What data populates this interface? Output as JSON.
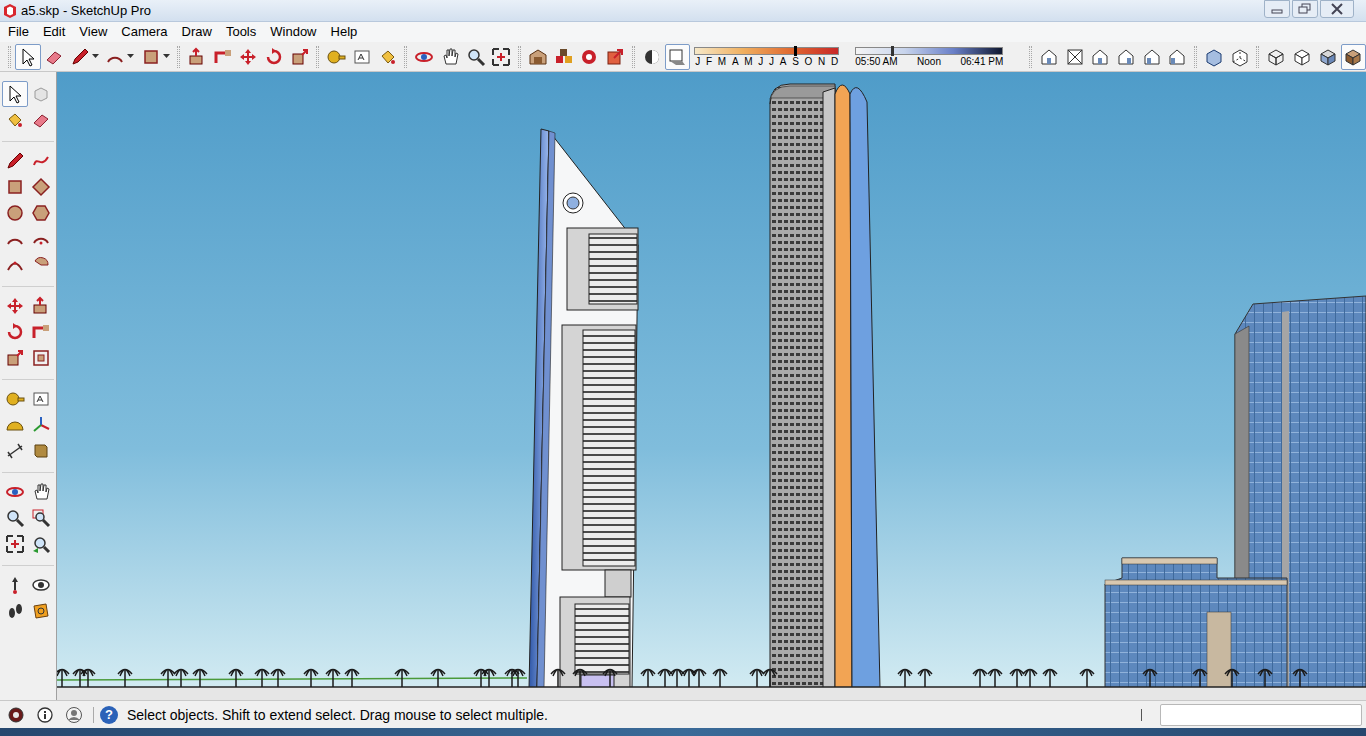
{
  "window": {
    "title": "a5.skp - SketchUp Pro"
  },
  "menu": [
    "File",
    "Edit",
    "View",
    "Camera",
    "Draw",
    "Tools",
    "Window",
    "Help"
  ],
  "top_toolbar": {
    "buttons": [
      {
        "selected": true
      },
      {
        "selected": false
      },
      {
        "selected": false
      },
      {
        "selected": false
      },
      {
        "selected": false
      },
      {
        "selected": false
      },
      {
        "selected": false
      },
      {
        "selected": false
      },
      {
        "selected": false
      },
      {
        "selected": false
      },
      {
        "selected": false
      },
      {
        "selected": false
      },
      {
        "selected": false
      },
      {
        "selected": false
      },
      {
        "selected": false
      },
      {
        "selected": false
      },
      {
        "selected": false
      },
      {
        "selected": false
      },
      {
        "selected": false
      },
      {
        "selected": false
      },
      {
        "selected": false
      },
      {
        "selected": false
      },
      {
        "selected": true
      },
      {
        "selected": false
      },
      {
        "selected": false
      },
      {
        "selected": false
      },
      {
        "selected": false
      },
      {
        "selected": false
      },
      {
        "selected": false
      },
      {
        "selected": false
      },
      {
        "selected": false
      },
      {
        "selected": false
      },
      {
        "selected": false
      },
      {
        "selected": false
      },
      {
        "selected": true
      }
    ]
  },
  "shadow_settings": {
    "months": [
      "J",
      "F",
      "M",
      "A",
      "M",
      "J",
      "J",
      "A",
      "S",
      "O",
      "N",
      "D"
    ],
    "date_level": 0.69,
    "time_labels": [
      "05:50 AM",
      "Noon",
      "06:41 PM"
    ],
    "time_level": 0.24
  },
  "left_toolbar": {
    "buttons": [
      {
        "selected": true
      },
      {
        "selected": false
      },
      {
        "selected": false
      },
      {
        "selected": false
      },
      {
        "selected": false
      },
      {
        "selected": false
      },
      {
        "selected": false
      },
      {
        "selected": false
      },
      {
        "selected": false
      },
      {
        "selected": false
      },
      {
        "selected": false
      },
      {
        "selected": false
      },
      {
        "selected": false
      },
      {
        "selected": false
      },
      {
        "selected": false
      },
      {
        "selected": false
      },
      {
        "selected": false
      },
      {
        "selected": false
      },
      {
        "selected": false
      },
      {
        "selected": false
      },
      {
        "selected": false
      },
      {
        "selected": false
      },
      {
        "selected": false
      },
      {
        "selected": false
      },
      {
        "selected": false
      },
      {
        "selected": false
      },
      {
        "selected": false
      },
      {
        "selected": false
      },
      {
        "selected": false
      },
      {
        "selected": false
      },
      {
        "selected": false
      },
      {
        "selected": false
      },
      {
        "selected": false
      },
      {
        "selected": false
      },
      {
        "selected": false
      },
      {
        "selected": false
      }
    ]
  },
  "status_bar": {
    "help_icon": "?",
    "message": "Select objects. Shift to extend select. Drag mouse to select multiple.",
    "measurements": ""
  }
}
